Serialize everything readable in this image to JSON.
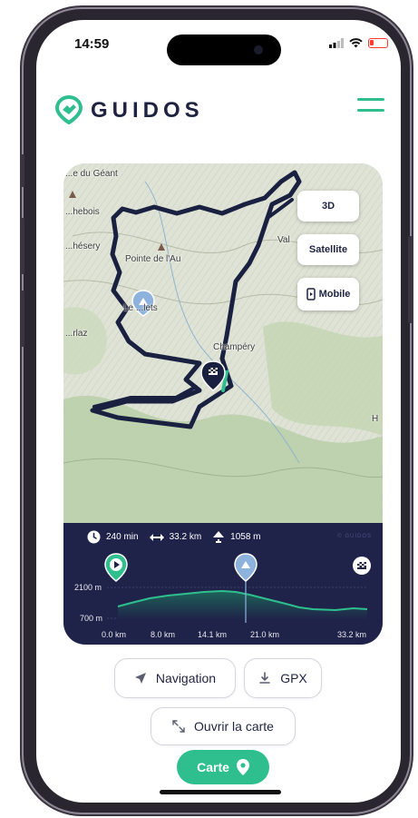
{
  "status_bar": {
    "time": "14:59"
  },
  "header": {
    "brand": "GUIDOS"
  },
  "colors": {
    "accent": "#2fbf8f",
    "navy": "#1f2349",
    "route": "#1a2140"
  },
  "map": {
    "labels": [
      "...e du Géant",
      "...hebois",
      "...hésery",
      "Pointe de l'Au",
      "Val",
      "Le ...lets",
      "...rlaz",
      "Champéry",
      "H"
    ],
    "buttons": {
      "three_d": "3D",
      "satellite": "Satellite",
      "mobile": "Mobile"
    }
  },
  "profile": {
    "duration": "240 min",
    "distance": "33.2 km",
    "elevation_gain": "1058 m",
    "brand_watermark": "© GUIDOS",
    "elev_axis": [
      "2100 m",
      "700 m"
    ],
    "km_axis": [
      "0.0 km",
      "8.0 km",
      "14.1 km",
      "21.0 km",
      "33.2 km"
    ]
  },
  "actions": {
    "navigation": "Navigation",
    "gpx": "GPX",
    "open_map": "Ouvrir la carte",
    "carte": "Carte"
  }
}
